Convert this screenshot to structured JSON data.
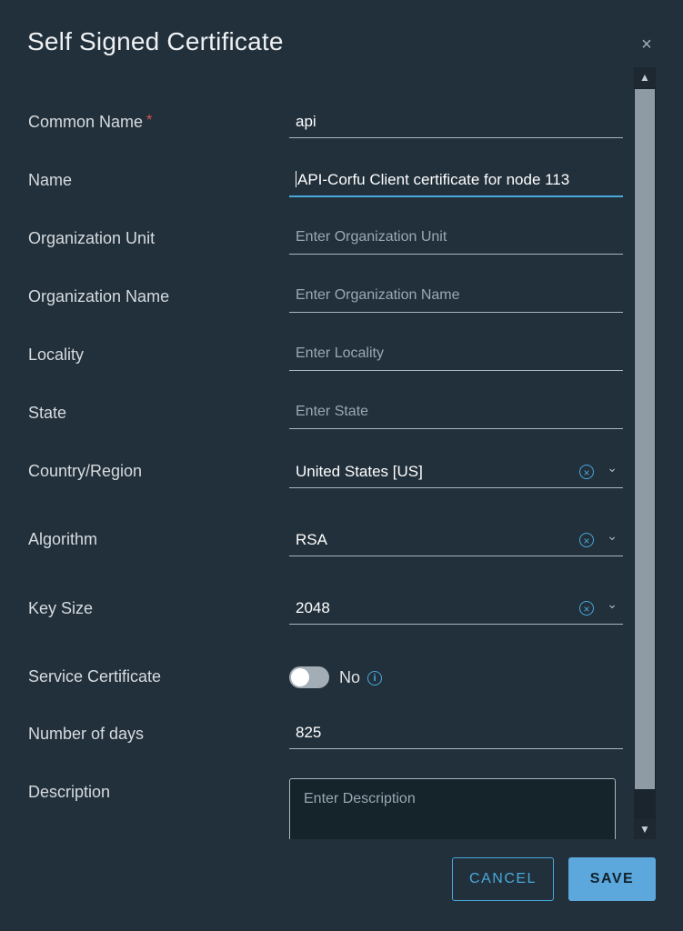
{
  "dialog": {
    "title": "Self Signed Certificate",
    "close_symbol": "×"
  },
  "form": {
    "common_name": {
      "label": "Common Name",
      "required_mark": "*",
      "value": "api"
    },
    "name": {
      "label": "Name",
      "value": "API-Corfu Client certificate for node 113"
    },
    "organization_unit": {
      "label": "Organization Unit",
      "placeholder": "Enter Organization Unit"
    },
    "organization_name": {
      "label": "Organization Name",
      "placeholder": "Enter Organization Name"
    },
    "locality": {
      "label": "Locality",
      "placeholder": "Enter Locality"
    },
    "state": {
      "label": "State",
      "placeholder": "Enter State"
    },
    "country_region": {
      "label": "Country/Region",
      "value": "United States [US]"
    },
    "algorithm": {
      "label": "Algorithm",
      "value": "RSA"
    },
    "key_size": {
      "label": "Key Size",
      "value": "2048"
    },
    "service_certificate": {
      "label": "Service Certificate",
      "toggle_text": "No",
      "enabled": false
    },
    "number_of_days": {
      "label": "Number of days",
      "value": "825"
    },
    "description": {
      "label": "Description",
      "placeholder": "Enter Description"
    }
  },
  "icons": {
    "clear": "clear-circle-x-icon",
    "dropdown": "chevron-down-icon",
    "info": "info-circle-icon",
    "close": "close-icon"
  },
  "footer": {
    "cancel_label": "CANCEL",
    "save_label": "SAVE"
  },
  "colors": {
    "accent": "#49a8dc",
    "primary_button": "#5ca7dc",
    "required": "#e05252",
    "background": "#22303b"
  }
}
